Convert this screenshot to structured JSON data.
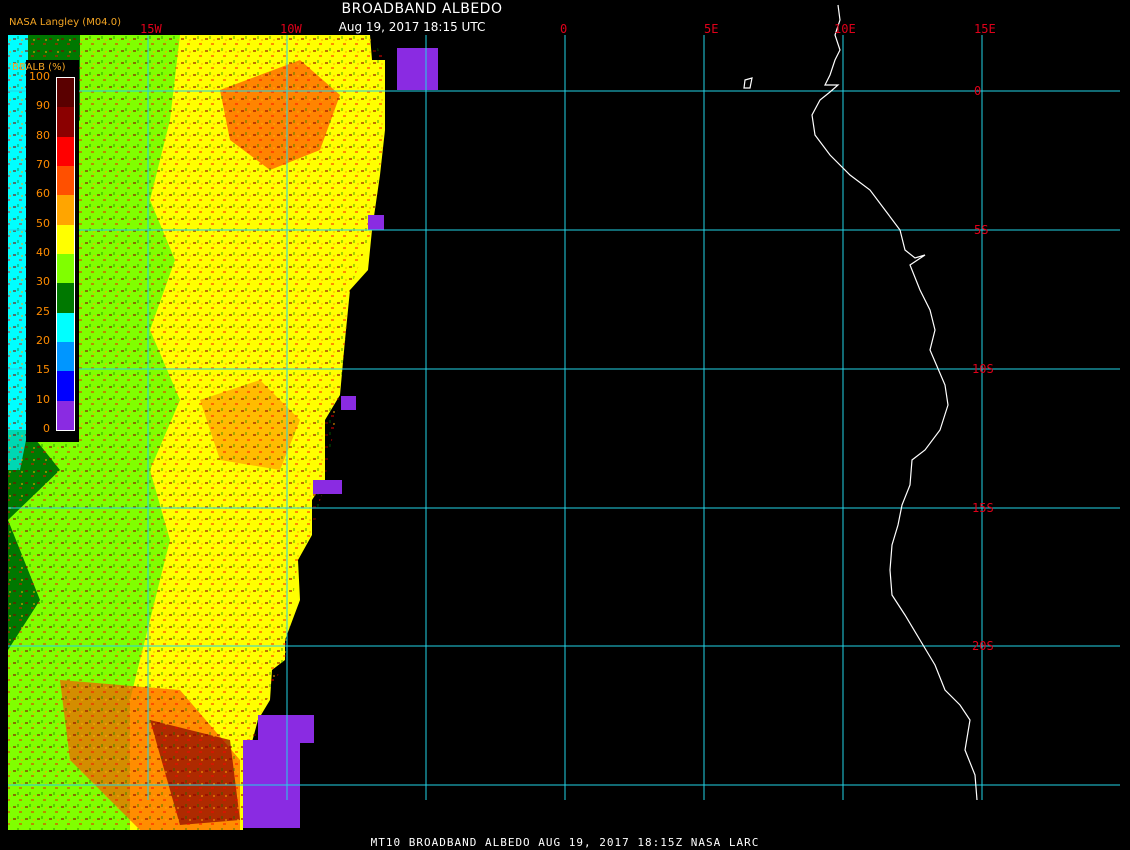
{
  "header": {
    "title": "BROADBAND ALBEDO",
    "subtitle": "Aug 19, 2017 18:15 UTC",
    "producer": "NASA Langley (M04.0)"
  },
  "legend": {
    "title": "BBALB (%)",
    "ticks": [
      "100",
      "90",
      "80",
      "70",
      "60",
      "50",
      "40",
      "30",
      "25",
      "20",
      "15",
      "10",
      "0"
    ],
    "colors": [
      "#5a0000",
      "#8b0000",
      "#ff0000",
      "#ff5000",
      "#ffa500",
      "#ffff00",
      "#80ff00",
      "#007800",
      "#00ffff",
      "#0096ff",
      "#0000ff",
      "#8a2be2"
    ]
  },
  "axes": {
    "lon_labels": [
      "15W",
      "10W",
      "0",
      "5E",
      "10E",
      "15E"
    ],
    "lat_labels": [
      "0",
      "5S",
      "10S",
      "15S",
      "20S"
    ]
  },
  "footer": "MT10  BROADBAND ALBEDO   AUG 19, 2017 18:15Z   NASA LARC",
  "colors": {
    "grid": "#22d3e6",
    "label": "#e0001a",
    "coast": "#ffffff",
    "ocean": "#000000"
  }
}
